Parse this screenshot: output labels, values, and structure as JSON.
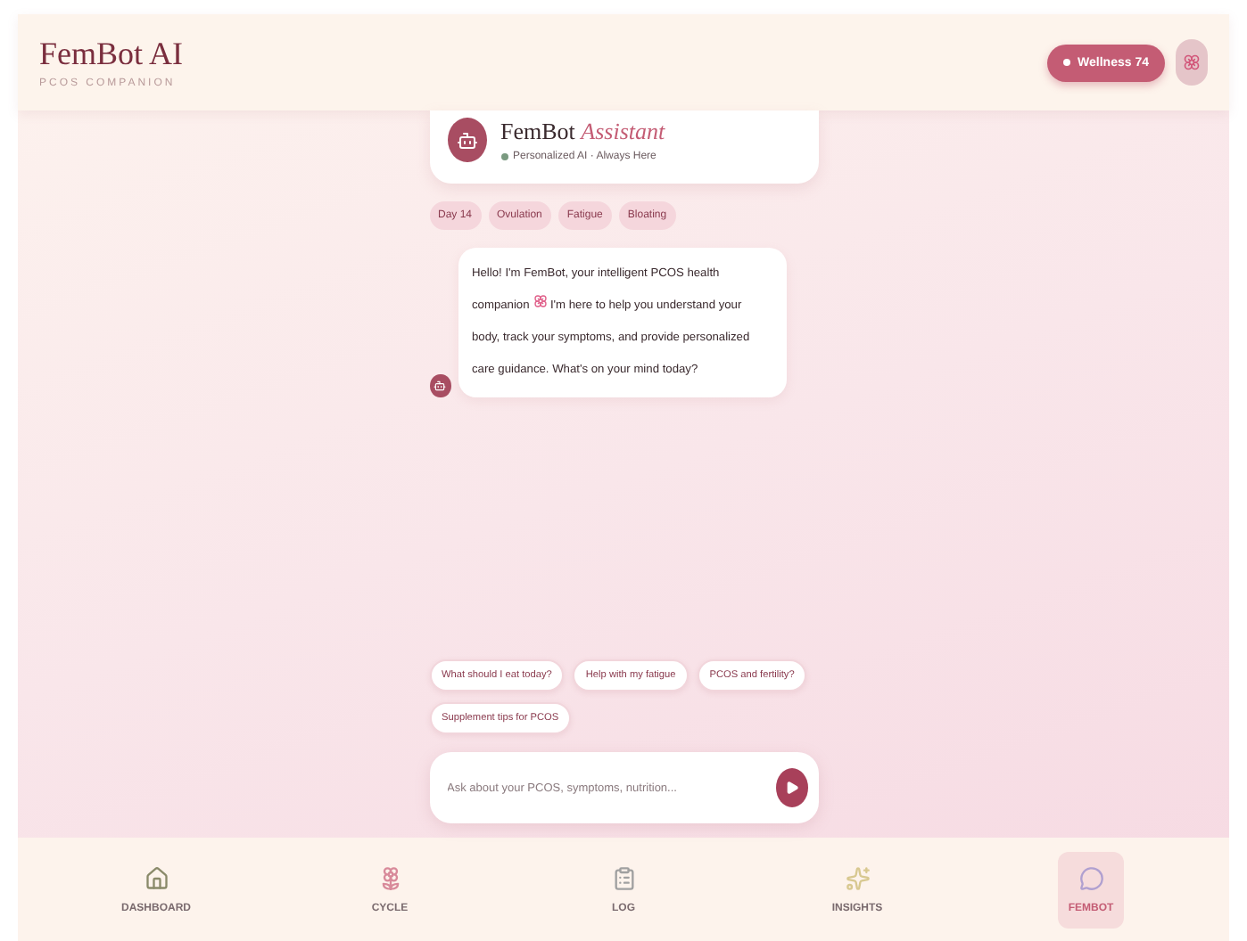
{
  "header": {
    "title": "FemBot AI",
    "subtitle": "PCOS COMPANION",
    "wellness": "Wellness 74"
  },
  "assistant": {
    "name": "FemBot",
    "name_accent": "Assistant",
    "status": "Personalized AI · Always Here"
  },
  "tags": [
    "Day 14",
    "Ovulation",
    "Fatigue",
    "Bloating"
  ],
  "messages": [
    {
      "kind": "bot",
      "before_icon": "Hello! I'm FemBot, your intelligent PCOS health companion",
      "after_icon": "I'm here to help you understand your body, track your symptoms, and provide personalized care guidance. What's on your mind today?"
    }
  ],
  "suggestions": [
    "What should I eat today?",
    "Help with my fatigue",
    "PCOS and fertility?",
    "Supplement tips for PCOS"
  ],
  "composer": {
    "placeholder": "Ask about your PCOS, symptoms, nutrition..."
  },
  "nav": [
    {
      "label": "DASHBOARD",
      "kind": "house",
      "selected": false
    },
    {
      "label": "CYCLE",
      "kind": "flower",
      "selected": false
    },
    {
      "label": "LOG",
      "kind": "clipboard",
      "selected": false
    },
    {
      "label": "INSIGHTS",
      "kind": "sparkles",
      "selected": false
    },
    {
      "label": "FEMBOT",
      "kind": "bubble",
      "selected": true
    }
  ]
}
